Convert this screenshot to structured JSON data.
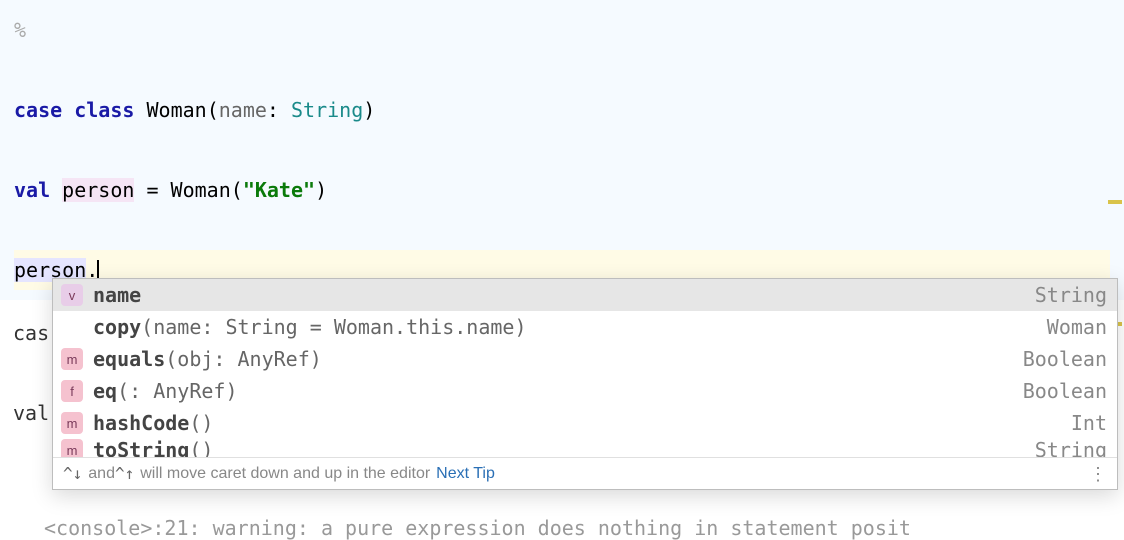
{
  "editor": {
    "prompt": "%",
    "line1": {
      "case": "case",
      "class": "class",
      "woman": "Woman",
      "lparen": "(",
      "name": "name",
      "colon": ": ",
      "type": "String",
      "rparen": ")"
    },
    "line2": {
      "val": "val",
      "person": "person",
      "eq": " = ",
      "woman": "Woman",
      "lparen": "(",
      "str": "\"Kate\"",
      "rparen": ")"
    },
    "line3": {
      "person": "person",
      "dot": "."
    },
    "behind_case": "cas",
    "behind_val": "val",
    "console_fragment": "<console>:21: warning: a pure expression does nothing in statement posit"
  },
  "completion": {
    "items": [
      {
        "kind": "v",
        "name": "name",
        "params": "",
        "ret": "String",
        "selected": true
      },
      {
        "kind": "",
        "name": "copy",
        "params": "(name: String = Woman.this.name)",
        "ret": "Woman",
        "selected": false
      },
      {
        "kind": "m",
        "name": "equals",
        "params": "(obj: AnyRef)",
        "ret": "Boolean",
        "selected": false
      },
      {
        "kind": "f",
        "name": "eq",
        "params": "(: AnyRef)",
        "ret": "Boolean",
        "selected": false
      },
      {
        "kind": "m",
        "name": "hashCode",
        "params": "()",
        "ret": "Int",
        "selected": false
      },
      {
        "kind": "m",
        "name": "toString",
        "params": "()",
        "ret": "String",
        "selected": false
      }
    ],
    "tip_prefix": "^↓",
    "tip_mid": " and ",
    "tip_prefix2": "^↑",
    "tip_text": " will move caret down and up in the editor",
    "tip_link": "Next Tip"
  }
}
